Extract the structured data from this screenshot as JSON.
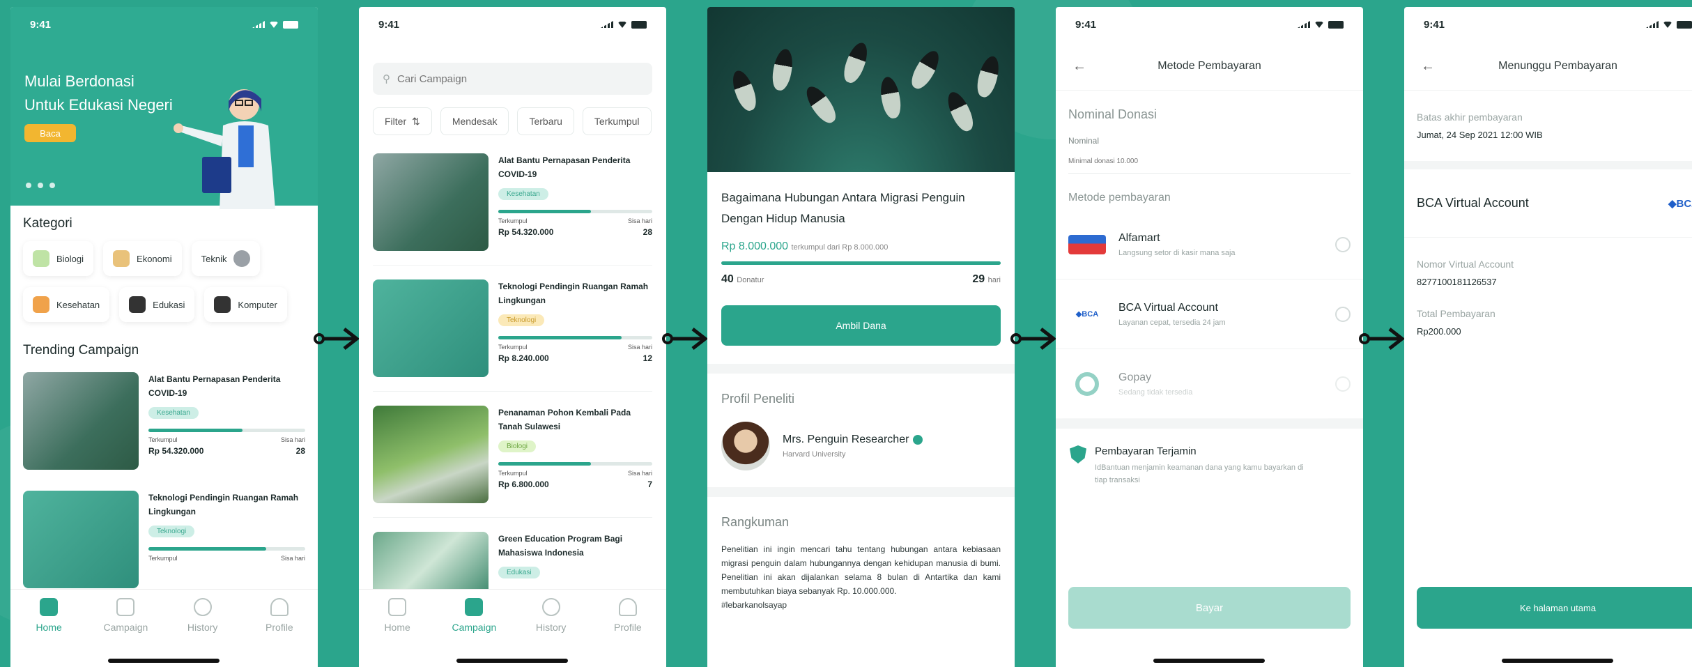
{
  "status_time": "9:41",
  "colors": {
    "brand": "#2ba58c",
    "accent_yellow": "#f2b630",
    "bca_blue": "#1f5fc9"
  },
  "screen1": {
    "hero_title_line1": "Mulai Berdonasi",
    "hero_title_line2": "Untuk Edukasi Negeri",
    "hero_button": "Baca",
    "categories_title": "Kategori",
    "categories": [
      {
        "label": "Biologi",
        "icon": "leaf-icon"
      },
      {
        "label": "Ekonomi",
        "icon": "money-bag-icon"
      },
      {
        "label": "Teknik",
        "icon": "gear-icon"
      },
      {
        "label": "Kesehatan",
        "icon": "pill-icon"
      },
      {
        "label": "Edukasi",
        "icon": "graduation-cap-icon"
      },
      {
        "label": "Komputer",
        "icon": "monitor-icon"
      }
    ],
    "trending_title": "Trending Campaign",
    "cards": [
      {
        "title": "Alat Bantu Pernapasan Penderita COVID-19",
        "tag": "Kesehatan",
        "collected_label": "Terkumpul",
        "collected": "Rp 54.320.000",
        "days_label": "Sisa hari",
        "days": "28",
        "progress": 0.6
      },
      {
        "title": "Teknologi Pendingin Ruangan Ramah Lingkungan",
        "tag": "Teknologi",
        "collected_label": "Terkumpul",
        "collected": "",
        "days_label": "Sisa hari",
        "days": "",
        "progress": 0.75
      }
    ],
    "nav": [
      "Home",
      "Campaign",
      "History",
      "Profile"
    ]
  },
  "screen2": {
    "search_placeholder": "Cari Campaign",
    "filters": [
      "Filter",
      "Mendesak",
      "Terbaru",
      "Terkumpul"
    ],
    "cards": [
      {
        "title": "Alat Bantu Pernapasan Penderita COVID-19",
        "tag": "Kesehatan",
        "collected_label": "Terkumpul",
        "collected": "Rp 54.320.000",
        "days_label": "Sisa hari",
        "days": "28",
        "progress": 0.6
      },
      {
        "title": "Teknologi Pendingin Ruangan Ramah Lingkungan",
        "tag": "Teknologi",
        "collected_label": "Terkumpul",
        "collected": "Rp 8.240.000",
        "days_label": "Sisa hari",
        "days": "12",
        "progress": 0.8
      },
      {
        "title": "Penanaman Pohon Kembali Pada Tanah Sulawesi",
        "tag": "Biologi",
        "collected_label": "Terkumpul",
        "collected": "Rp 6.800.000",
        "days_label": "Sisa hari",
        "days": "7",
        "progress": 0.6
      },
      {
        "title": "Green Education Program Bagi Mahasiswa Indonesia",
        "tag": "Edukasi",
        "collected_label": "",
        "collected": "",
        "days_label": "",
        "days": "",
        "progress": 0
      }
    ],
    "nav": [
      "Home",
      "Campaign",
      "History",
      "Profile"
    ]
  },
  "screen3": {
    "title": "Bagaimana Hubungan Antara Migrasi Penguin Dengan Hidup Manusia",
    "raised": "Rp 8.000.000",
    "raised_suffix": "terkumpul dari Rp 8.000.000",
    "progress": 1.0,
    "donors": "40",
    "donors_label": "Donatur",
    "days": "29",
    "days_label": "hari",
    "cta": "Ambil Dana",
    "profile_title": "Profil Peneliti",
    "researcher_name": "Mrs. Penguin Researcher",
    "researcher_uni": "Harvard University",
    "summary_title": "Rangkuman",
    "summary": "Penelitian ini ingin mencari tahu tentang hubungan antara kebiasaan migrasi penguin dalam hubungannya dengan kehidupan manusia di bumi. Penelitian ini akan dijalankan selama 8 bulan di Antartika dan kami membutuhkan biaya sebanyak Rp. 10.000.000.",
    "hashtag": "#lebarkanolsayap"
  },
  "screen4": {
    "title": "Metode Pembayaran",
    "nominal_title": "Nominal Donasi",
    "nominal_label": "Nominal",
    "nominal_placeholder": "Minimal donasi 10.000",
    "method_title": "Metode pembayaran",
    "methods": [
      {
        "name": "Alfamart",
        "desc": "Langsung setor di kasir mana saja"
      },
      {
        "name": "BCA Virtual Account",
        "desc": "Layanan cepat, tersedia 24 jam"
      },
      {
        "name": "Gopay",
        "desc": "Sedang tidak tersedia"
      }
    ],
    "secure_title": "Pembayaran Terjamin",
    "secure_desc": "IdBantuan menjamin keamanan dana yang kamu bayarkan di tiap transaksi",
    "pay_button": "Bayar"
  },
  "screen5": {
    "title": "Menunggu Pembayaran",
    "deadline_label": "Batas akhir pembayaran",
    "deadline": "Jumat, 24 Sep 2021 12:00 WIB",
    "method": "BCA Virtual Account",
    "bca_logo": "BCA",
    "va_label": "Nomor Virtual Account",
    "va_number": "8277100181126537",
    "total_label": "Total Pembayaran",
    "total": "Rp200.000",
    "home_button": "Ke halaman utama"
  }
}
